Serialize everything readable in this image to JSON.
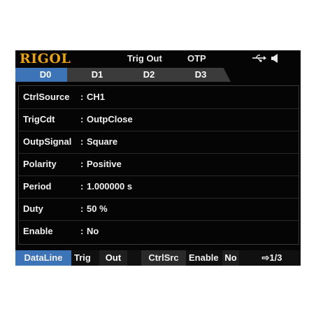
{
  "header": {
    "brand": "RIGOL",
    "mode_label": "Trig Out",
    "status_label": "OTP",
    "usb_icon": "usb-icon",
    "speaker_icon": "speaker-icon"
  },
  "tabs": [
    {
      "label": "D0",
      "active": true
    },
    {
      "label": "D1",
      "active": false
    },
    {
      "label": "D2",
      "active": false
    },
    {
      "label": "D3",
      "active": false
    }
  ],
  "params": [
    {
      "label": "CtrlSource",
      "value": "CH1"
    },
    {
      "label": "TrigCdt",
      "value": "OutpClose"
    },
    {
      "label": "OutpSignal",
      "value": "Square"
    },
    {
      "label": "Polarity",
      "value": "Positive"
    },
    {
      "label": "Period",
      "value": "1.000000 s"
    },
    {
      "label": "Duty",
      "value": "50 %"
    },
    {
      "label": "Enable",
      "value": "No"
    }
  ],
  "softkeys": {
    "dataline": "DataLine",
    "trig_label": "Trig",
    "trig_value": "Out",
    "ctrlsrc": "CtrlSrc",
    "enable_label": "Enable",
    "enable_value": "No",
    "page": "⇨1/3"
  },
  "colors": {
    "accent": "#3d73b7",
    "brand": "#e8a21a",
    "background": "#050505"
  }
}
